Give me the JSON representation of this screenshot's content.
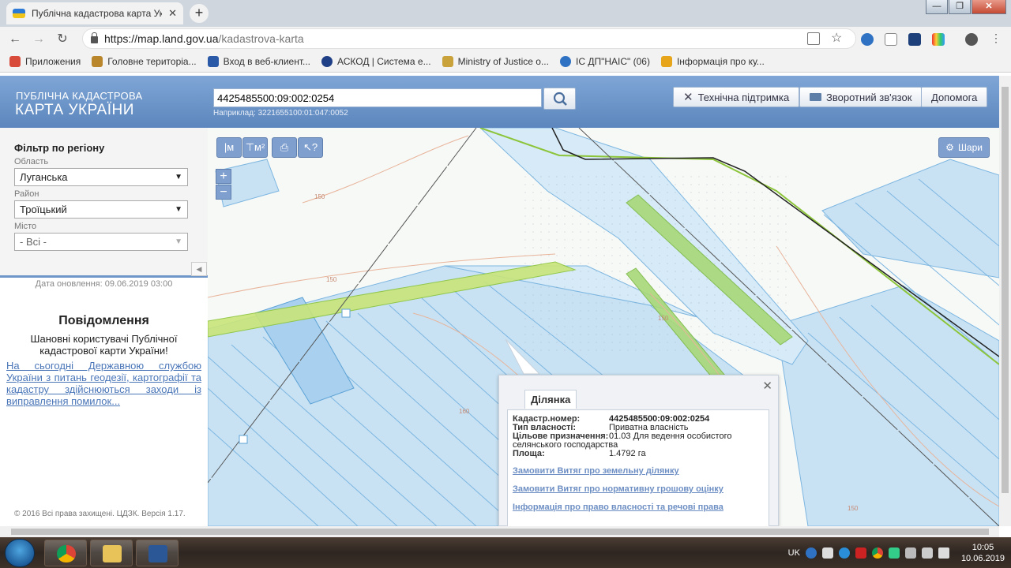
{
  "browser": {
    "tab_title": "Публічна кадастрова карта Укр",
    "tab_close": "✕",
    "new_tab": "+",
    "url_host": "https://map.land.gov.ua",
    "url_path": "/kadastrova-karta",
    "window_controls": [
      "—",
      "❐",
      "✕"
    ]
  },
  "bookmarks": [
    {
      "label": "Приложения",
      "color": "#d84a3a"
    },
    {
      "label": "Головне територіа...",
      "color": "#b9862c"
    },
    {
      "label": "Вход в веб-клиент...",
      "color": "#2a59a8"
    },
    {
      "label": "АСКОД | Система е...",
      "color": "#1f3f86"
    },
    {
      "label": "Ministry of Justice о...",
      "color": "#c9a23c"
    },
    {
      "label": "ІС ДП\"НАІС\" (06)",
      "color": "#2f72c4"
    },
    {
      "label": "Інформація про ку...",
      "color": "#e6a51a"
    }
  ],
  "header": {
    "logo_line1": "ПУБЛІЧНА КАДАСТРОВА",
    "logo_line2": "КАРТА УКРАЇНИ",
    "search_value": "4425485500:09:002:0254",
    "search_hint": "Наприклад: 3221655100:01:047:0052",
    "buttons": {
      "support": "Технічна підтримка",
      "feedback": "Зворотний зв'язок",
      "help": "Допомога"
    }
  },
  "sidebar": {
    "filter_title": "Фільтр по регіону",
    "oblast_label": "Область",
    "oblast_value": "Луганська",
    "rayon_label": "Район",
    "rayon_value": "Троїцький",
    "city_label": "Місто",
    "city_value": "- Всі -",
    "collapse": "◀",
    "updated": "Дата оновлення: 09.06.2019 03:00",
    "message_title": "Повідомлення",
    "message_text": "Шановні користувачі Публічної кадастрової карти України!",
    "message_link": "На сьогодні Державною службою України з питань геодезії, картографії та кадастру здійснюються заходи із виправлення помилок...",
    "copyright": "© 2016 Всі права захищені. ЦДЗК. Версія 1.17."
  },
  "map": {
    "tools": {
      "ruler": "|м",
      "area": "⊤м²",
      "print": "⎙",
      "info": "↖?"
    },
    "zoom_in": "+",
    "zoom_out": "−",
    "layers": "Шари",
    "contours": [
      "150",
      "150",
      "160",
      "150",
      "150"
    ]
  },
  "popup": {
    "close": "✕",
    "tab": "Ділянка",
    "fields": [
      {
        "key": "Кадастр.номер:",
        "value": "4425485500:09:002:0254",
        "bold": true
      },
      {
        "key": "Тип власності:",
        "value": "Приватна власність",
        "bold": false
      },
      {
        "key": "Цільове призначення:",
        "value": "01.03 Для ведення особистого",
        "bold": false
      }
    ],
    "purpose_cont": "селянського господарства",
    "area_key": "Площа:",
    "area_value": "1.4792 га",
    "links": [
      "Замовити Витяг про земельну ділянку",
      "Замовити Витяг про нормативну грошову оцінку",
      "Інформація про право власності та речові права"
    ]
  },
  "taskbar": {
    "lang": "UK",
    "time": "10:05",
    "date": "10.06.2019"
  }
}
